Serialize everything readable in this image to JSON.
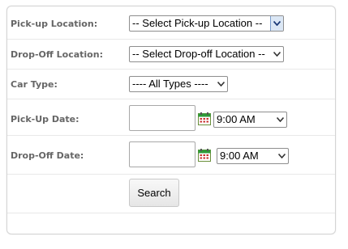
{
  "form": {
    "pickup_location": {
      "label": "Pick-up Location:",
      "value": "-- Select Pick-up Location --"
    },
    "dropoff_location": {
      "label": "Drop-Off Location:",
      "value": "-- Select Drop-off Location --"
    },
    "car_type": {
      "label": "Car Type:",
      "value": "---- All Types ----"
    },
    "pickup_date": {
      "label": "Pick-Up Date:",
      "date_value": "",
      "time_value": "9:00 AM"
    },
    "dropoff_date": {
      "label": "Drop-Off Date:",
      "date_value": "",
      "time_value": "9:00 AM"
    },
    "search_label": "Search"
  },
  "icons": {
    "calendar": "calendar-icon",
    "dropdown": "chevron-down-icon"
  },
  "colors": {
    "label_text": "#666666",
    "calendar_green": "#2e9b3a",
    "calendar_red": "#c8302e",
    "row_divider": "#e8e8e8"
  }
}
